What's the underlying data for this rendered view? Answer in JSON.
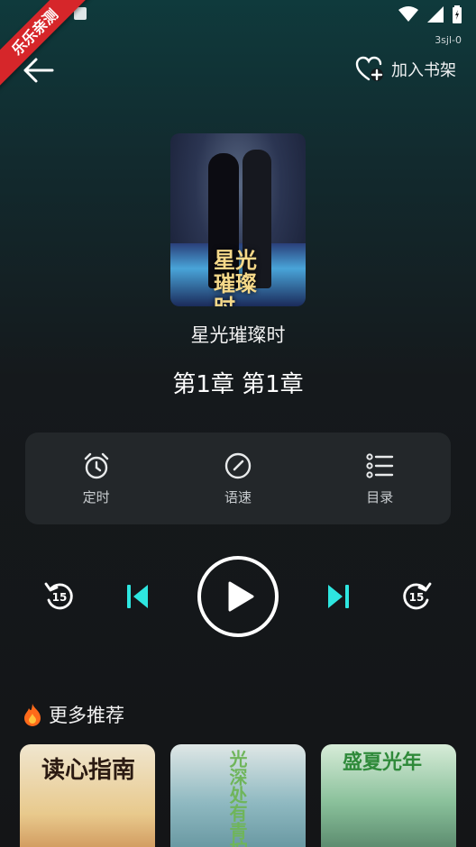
{
  "status": {
    "carrier_note": "3sjl-0"
  },
  "watermark": {
    "text": "乐乐亲测"
  },
  "header": {
    "add_shelf_label": "加入书架"
  },
  "book": {
    "cover_title": "星光璀璨时",
    "title": "星光璀璨时",
    "chapter": "第1章  第1章"
  },
  "panel": {
    "items": [
      {
        "label": "定时",
        "icon": "alarm-clock-icon"
      },
      {
        "label": "语速",
        "icon": "speed-gauge-icon"
      },
      {
        "label": "目录",
        "icon": "list-icon"
      }
    ]
  },
  "player": {
    "rewind_seconds": "15",
    "forward_seconds": "15",
    "accent": "#2ee6e0",
    "state": "paused"
  },
  "more": {
    "title": "更多推荐",
    "items": [
      {
        "cover_text": "读心指南"
      },
      {
        "cover_text": "光深处有青柠"
      },
      {
        "cover_text": "盛夏光年"
      }
    ]
  }
}
